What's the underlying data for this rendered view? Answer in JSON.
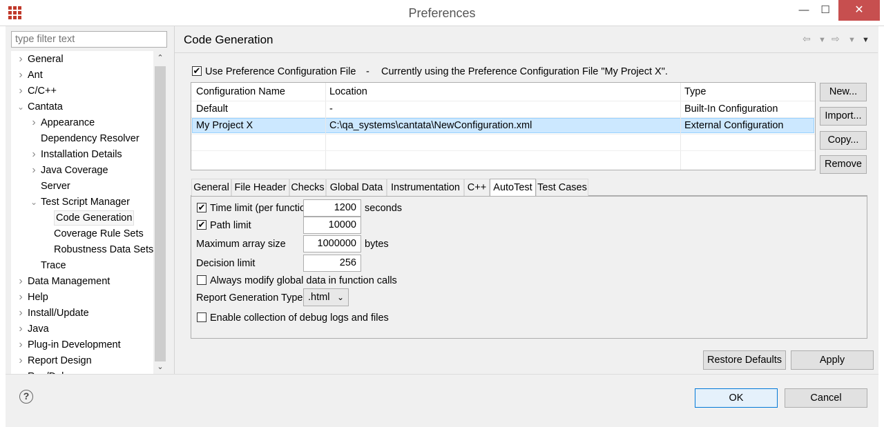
{
  "window": {
    "title": "Preferences",
    "minimize_glyph": "—",
    "maximize_glyph": "☐",
    "close_glyph": "✕"
  },
  "filter": {
    "placeholder": "type filter text"
  },
  "tree": {
    "items": [
      {
        "label": "General",
        "level": 0,
        "arrow": "›"
      },
      {
        "label": "Ant",
        "level": 0,
        "arrow": "›"
      },
      {
        "label": "C/C++",
        "level": 0,
        "arrow": "›"
      },
      {
        "label": "Cantata",
        "level": 0,
        "arrow": "⌄"
      },
      {
        "label": "Appearance",
        "level": 1,
        "arrow": "›"
      },
      {
        "label": "Dependency Resolver",
        "level": 1,
        "arrow": ""
      },
      {
        "label": "Installation Details",
        "level": 1,
        "arrow": "›"
      },
      {
        "label": "Java Coverage",
        "level": 1,
        "arrow": "›"
      },
      {
        "label": "Server",
        "level": 1,
        "arrow": ""
      },
      {
        "label": "Test Script Manager",
        "level": 1,
        "arrow": "⌄"
      },
      {
        "label": "Code Generation",
        "level": 2,
        "arrow": "",
        "selected": true
      },
      {
        "label": "Coverage Rule Sets",
        "level": 2,
        "arrow": ""
      },
      {
        "label": "Robustness Data Sets",
        "level": 2,
        "arrow": ""
      },
      {
        "label": "Trace",
        "level": 1,
        "arrow": ""
      },
      {
        "label": "Data Management",
        "level": 0,
        "arrow": "›"
      },
      {
        "label": "Help",
        "level": 0,
        "arrow": "›"
      },
      {
        "label": "Install/Update",
        "level": 0,
        "arrow": "›"
      },
      {
        "label": "Java",
        "level": 0,
        "arrow": "›"
      },
      {
        "label": "Plug-in Development",
        "level": 0,
        "arrow": "›"
      },
      {
        "label": "Report Design",
        "level": 0,
        "arrow": "›"
      },
      {
        "label": "Run/Debug",
        "level": 0,
        "arrow": "›"
      }
    ],
    "scroll_up": "⌃",
    "scroll_down": "⌄"
  },
  "page": {
    "title": "Code Generation",
    "use_config_label": "Use Preference Configuration File",
    "use_config_checked": "✔",
    "dash": "-",
    "status_text": "Currently using the Preference Configuration File \"My Project X\"."
  },
  "config_table": {
    "columns": [
      "Configuration Name",
      "Location",
      "Type"
    ],
    "rows": [
      [
        "Default",
        "-",
        "Built-In Configuration"
      ],
      [
        "My Project X",
        "C:\\qa_systems\\cantata\\NewConfiguration.xml",
        "External Configuration"
      ]
    ]
  },
  "config_buttons": {
    "new": "New...",
    "import": "Import...",
    "copy": "Copy...",
    "remove": "Remove"
  },
  "tabs": [
    "General",
    "File Header",
    "Checks",
    "Global Data",
    "Instrumentation",
    "C++",
    "AutoTest",
    "Test Cases"
  ],
  "autotest": {
    "time_limit_label": "Time limit (per function)",
    "time_limit_value": "1200",
    "time_limit_unit": "seconds",
    "path_limit_label": "Path limit",
    "path_limit_value": "10000",
    "max_array_label": "Maximum array size",
    "max_array_value": "1000000",
    "max_array_unit": "bytes",
    "decision_limit_label": "Decision limit",
    "decision_limit_value": "256",
    "modify_global_label": "Always modify global data in function calls",
    "report_type_label": "Report Generation Type",
    "report_type_value": ".html",
    "debug_logs_label": "Enable collection of debug logs and files",
    "check_glyph": "✔"
  },
  "actions": {
    "restore_defaults": "Restore Defaults",
    "apply": "Apply",
    "ok": "OK",
    "cancel": "Cancel",
    "help": "?"
  },
  "colors": {
    "close_button": "#c74f4f",
    "selection": "#cce8ff",
    "app_icon": "#c0392b"
  }
}
